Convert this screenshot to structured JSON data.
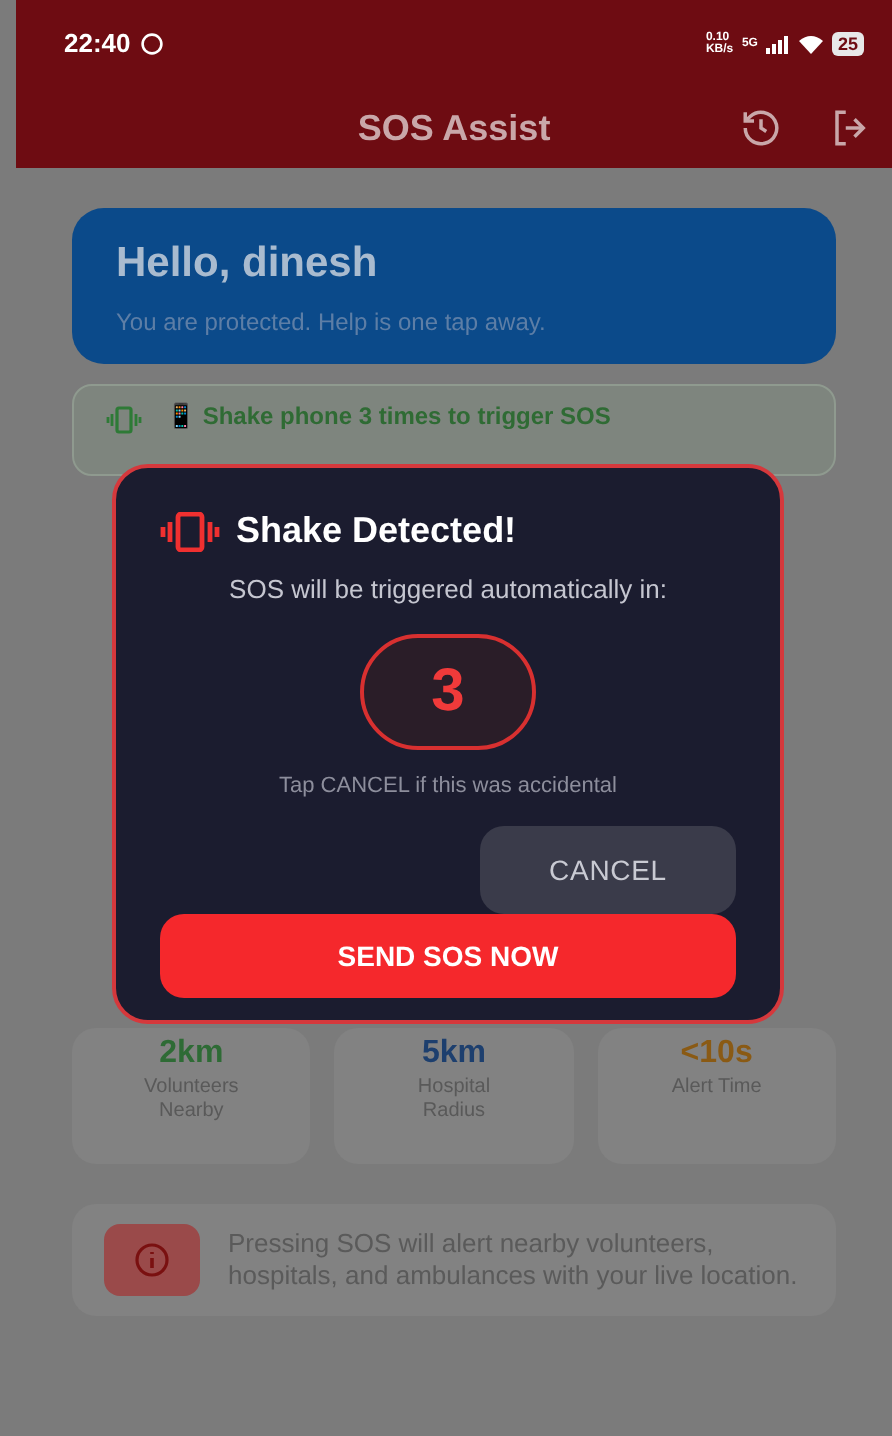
{
  "status_bar": {
    "time": "22:40",
    "net_speed": "0.10 KB/s",
    "network": "5G",
    "battery": "25"
  },
  "app_bar": {
    "title": "SOS Assist"
  },
  "greeting": {
    "title": "Hello, dinesh",
    "subtitle": "You are protected. Help is one tap away."
  },
  "shake_banner": {
    "text": "📱 Shake phone 3 times to trigger SOS"
  },
  "stats": [
    {
      "value": "2km",
      "label": "Volunteers Nearby",
      "color": "#2e6b35"
    },
    {
      "value": "5km",
      "label": "Hospital Radius",
      "color": "#1d3f6e"
    },
    {
      "value": "<10s",
      "label": "Alert Time",
      "color": "#8a5a14"
    }
  ],
  "info": {
    "text": "Pressing SOS will alert nearby volunteers, hospitals, and ambulances with your live location."
  },
  "dialog": {
    "title": "Shake Detected!",
    "message": "SOS will be triggered automatically in:",
    "countdown": "3",
    "hint": "Tap CANCEL if this was accidental",
    "buttons": [
      {
        "label": "CANCEL",
        "kind": "secondary"
      },
      {
        "label": "SEND SOS NOW",
        "kind": "primary"
      }
    ]
  }
}
